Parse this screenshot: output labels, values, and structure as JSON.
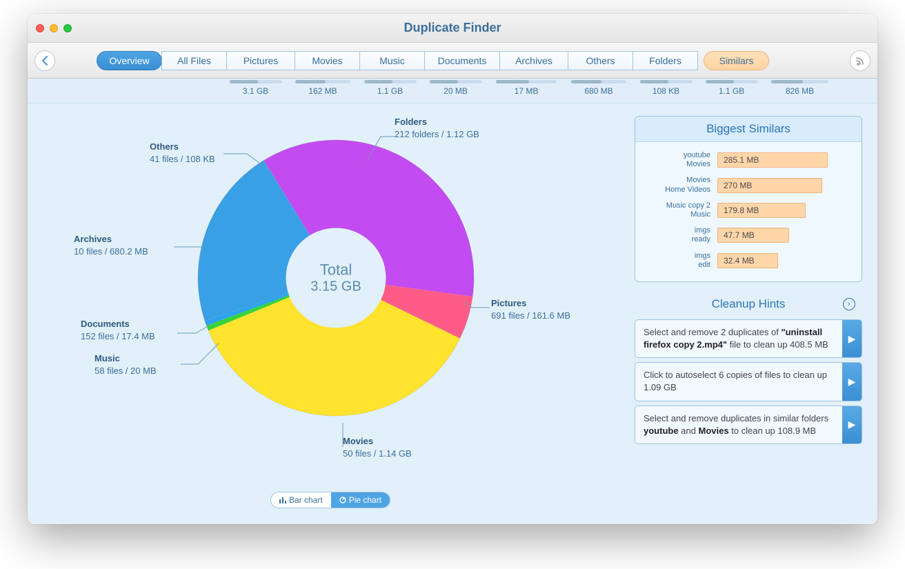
{
  "window": {
    "title": "Duplicate Finder"
  },
  "tabs": [
    {
      "label": "Overview",
      "size": "",
      "active": true
    },
    {
      "label": "All Files",
      "size": "3.1 GB"
    },
    {
      "label": "Pictures",
      "size": "162 MB"
    },
    {
      "label": "Movies",
      "size": "1.1 GB"
    },
    {
      "label": "Music",
      "size": "20 MB"
    },
    {
      "label": "Documents",
      "size": "17 MB"
    },
    {
      "label": "Archives",
      "size": "680 MB"
    },
    {
      "label": "Others",
      "size": "108 KB"
    },
    {
      "label": "Folders",
      "size": "1.1 GB"
    }
  ],
  "similars_tab": {
    "label": "Similars",
    "size": "826 MB"
  },
  "center": {
    "label": "Total",
    "size": "3.15 GB"
  },
  "callouts": {
    "folders": {
      "cat": "Folders",
      "det": "212 folders / 1.12 GB"
    },
    "others": {
      "cat": "Others",
      "det": "41 files / 108 KB"
    },
    "archives": {
      "cat": "Archives",
      "det": "10 files / 680.2 MB"
    },
    "documents": {
      "cat": "Documents",
      "det": "152 files / 17.4 MB"
    },
    "music": {
      "cat": "Music",
      "det": "58 files / 20 MB"
    },
    "movies": {
      "cat": "Movies",
      "det": "50 files / 1.14 GB"
    },
    "pictures": {
      "cat": "Pictures",
      "det": "691 files / 161.6 MB"
    }
  },
  "toggle": {
    "bar": "Bar chart",
    "pie": "Pie chart"
  },
  "biggest": {
    "title": "Biggest Similars",
    "items": [
      {
        "name": "youtube",
        "sub": "Movies",
        "size": "285.1 MB",
        "pct": 100
      },
      {
        "name": "Movies",
        "sub": "Home Videos",
        "size": "270 MB",
        "pct": 95
      },
      {
        "name": "Music copy 2",
        "sub": "Music",
        "size": "179.8 MB",
        "pct": 80
      },
      {
        "name": "imgs",
        "sub": "ready",
        "size": "47.7 MB",
        "pct": 65
      },
      {
        "name": "imgs",
        "sub": "edit",
        "size": "32.4 MB",
        "pct": 55
      }
    ]
  },
  "hints": {
    "title": "Cleanup Hints",
    "items": [
      {
        "pre": "Select and remove 2 duplicates of ",
        "bold": "\"uninstall firefox copy 2.mp4\"",
        "post": " file to clean up 408.5 MB"
      },
      {
        "pre": "Click to autoselect 6 copies of files to clean up 1.09 GB",
        "bold": "",
        "post": ""
      },
      {
        "pre": "Select and remove duplicates in similar folders ",
        "bold": "youtube",
        "mid": " and ",
        "bold2": "Movies",
        "post": " to clean up 108.9 MB"
      }
    ]
  },
  "chart_data": {
    "type": "pie",
    "title": "Total 3.15 GB",
    "series": [
      {
        "name": "Folders",
        "value_label": "1.12 GB",
        "value_bytes": 1202590842,
        "count": 212,
        "color": "#c24cf0"
      },
      {
        "name": "Pictures",
        "value_label": "161.6 MB",
        "value_bytes": 169450701,
        "count": 691,
        "color": "#ff5b88"
      },
      {
        "name": "Movies",
        "value_label": "1.14 GB",
        "value_bytes": 1224065679,
        "count": 50,
        "color": "#ffe32e"
      },
      {
        "name": "Music",
        "value_label": "20 MB",
        "value_bytes": 20971520,
        "count": 58,
        "color": "#3ad23a"
      },
      {
        "name": "Documents",
        "value_label": "17.4 MB",
        "value_bytes": 18245222,
        "count": 152,
        "color": "#2aa3ef"
      },
      {
        "name": "Archives",
        "value_label": "680.2 MB",
        "value_bytes": 713240166,
        "count": 10,
        "color": "#39a0e6"
      },
      {
        "name": "Others",
        "value_label": "108 KB",
        "value_bytes": 110592,
        "count": 41,
        "color": "#5ab6f2"
      }
    ]
  }
}
